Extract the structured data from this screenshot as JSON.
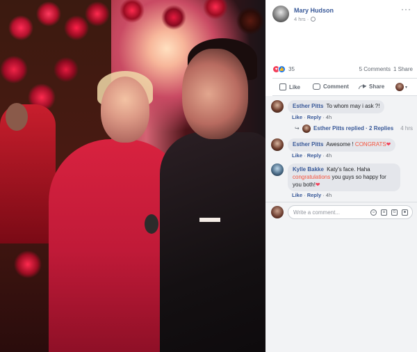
{
  "post": {
    "author": "Mary Hudson",
    "time": "4 hrs ·",
    "more": "···"
  },
  "reactions": {
    "count": "35",
    "comments": "5 Comments",
    "shares": "1 Share"
  },
  "actions": {
    "like": "Like",
    "comment": "Comment",
    "share": "Share",
    "caret": "▾"
  },
  "comments": [
    {
      "name": "Esther Pitts",
      "text": "To whom may i ask ?!",
      "like": "Like",
      "reply": "Reply",
      "time": "4h"
    },
    {
      "name": "Esther Pitts",
      "text_before": "Awesome !",
      "highlight": "CONGRATS",
      "heart": "❤",
      "like": "Like",
      "reply": "Reply",
      "time": "4h"
    },
    {
      "name": "Kylle Bakke",
      "text_before": "Katy's face. Haha",
      "highlight": "congratulations",
      "text_after": "you guys so happy for you both!",
      "heart": "❤",
      "like": "Like",
      "reply": "Reply",
      "time": "4h"
    }
  ],
  "replies_summary": {
    "text": "Esther Pitts replied · 2 Replies",
    "time": "4 hrs",
    "arrow": "↪"
  },
  "composer": {
    "placeholder": "Write a comment..."
  },
  "colors": {
    "link": "#385898",
    "highlight": "#f5533d",
    "love": "#f33e58",
    "like": "#1877f2"
  }
}
